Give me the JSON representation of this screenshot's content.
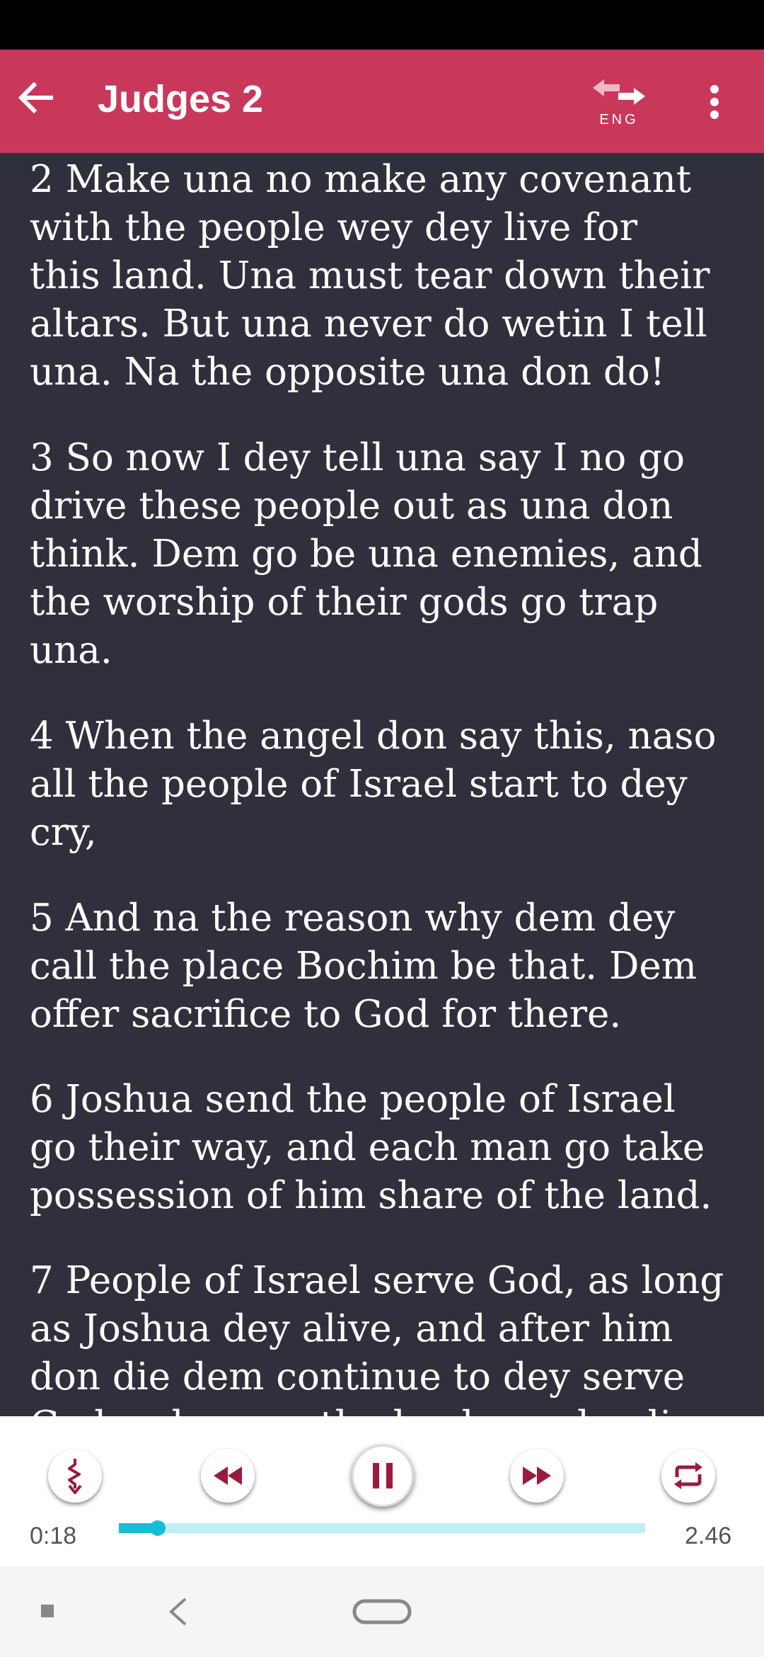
{
  "app_bar": {
    "title": "Judges 2",
    "language_label": "ENG",
    "icons": [
      "arrow-left-icon",
      "language-swap-icon",
      "more-vertical-icon"
    ]
  },
  "verses": [
    "2 Make una no make any covenant\nwith the people wey dey live for\nthis land. Una must tear down their\naltars. But una never do wetin I tell\nuna. Na the opposite una don do!",
    "3 So now I dey tell una say I no go\ndrive these people out as una don\nthink. Dem go be una enemies, and\nthe worship of their gods go trap\nuna.",
    "4 When the angel don say this, naso\nall the people of Israel start to dey\ncry,",
    "5 And na the reason why dem dey\ncall the place Bochim be that. Dem\noffer sacrifice to God for there.",
    "6 Joshua send the people of Israel\ngo their way, and each man go take\npossession of him share of the land.",
    "7 People of Israel serve God, as long\nas Joshua dey alive, and after him\ndon die dem continue to dey serve\nGod as long as the leaders who dis"
  ],
  "player": {
    "elapsed": "0:18",
    "duration": "2.46",
    "progress": 0.074,
    "controls": [
      "speed-icon",
      "rewind-icon",
      "pause-icon",
      "fast-forward-icon",
      "repeat-icon"
    ],
    "accent_color": "#9b1b3f",
    "progress_color": "#18bcd7"
  },
  "colors": {
    "app_bar": "#c9385a",
    "background": "#2f303b",
    "text": "#ffffff"
  },
  "system_nav": [
    "recents-icon",
    "back-icon",
    "home-icon"
  ]
}
